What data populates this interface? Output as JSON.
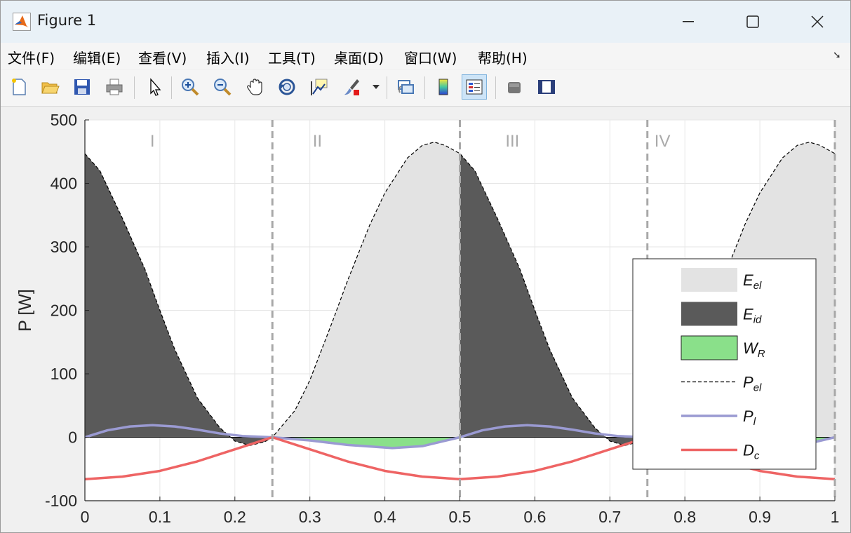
{
  "window": {
    "title": "Figure 1"
  },
  "menu": [
    "文件(F)",
    "编辑(E)",
    "查看(V)",
    "插入(I)",
    "工具(T)",
    "桌面(D)",
    "窗口(W)",
    "帮助(H)"
  ],
  "toolbar": [
    "new-figure-icon",
    "open-file-icon",
    "save-icon",
    "print-icon",
    "edit-plot-icon",
    "zoom-in-icon",
    "zoom-out-icon",
    "pan-icon",
    "rotate-3d-icon",
    "data-cursor-icon",
    "brush-icon",
    "link-plot-icon",
    "colorbar-icon",
    "legend-icon",
    "hide-plot-tools-icon",
    "show-plot-tools-icon"
  ],
  "chart_data": {
    "type": "area",
    "xlabel": "",
    "ylabel": "P [W]",
    "xlim": [
      0,
      1
    ],
    "ylim": [
      -100,
      500
    ],
    "xticks": [
      "0",
      "0.1",
      "0.2",
      "0.3",
      "0.4",
      "0.5",
      "0.6",
      "0.7",
      "0.8",
      "0.9",
      "1"
    ],
    "yticks": [
      "-100",
      "0",
      "100",
      "200",
      "300",
      "400",
      "500"
    ],
    "grid": true,
    "legend_position": "right",
    "region_labels": [
      {
        "text": "I",
        "x": 0.09
      },
      {
        "text": "II",
        "x": 0.31
      },
      {
        "text": "III",
        "x": 0.57
      },
      {
        "text": "IV",
        "x": 0.77
      }
    ],
    "phase_boundaries": [
      0.25,
      0.5,
      0.75,
      1.0
    ],
    "series": [
      {
        "name": "E_el",
        "kind": "area",
        "color": "#e3e3e3",
        "x": [
          0.25,
          0.28,
          0.3,
          0.33,
          0.35,
          0.38,
          0.4,
          0.43,
          0.45,
          0.466,
          0.48,
          0.5,
          0.75,
          0.78,
          0.8,
          0.83,
          0.85,
          0.88,
          0.9,
          0.93,
          0.95,
          0.966,
          0.98,
          1.0
        ],
        "y": [
          0,
          42,
          90,
          182,
          246,
          335,
          385,
          440,
          460,
          465,
          460,
          447,
          0,
          42,
          90,
          182,
          246,
          335,
          385,
          440,
          460,
          465,
          460,
          447
        ]
      },
      {
        "name": "E_id",
        "kind": "area",
        "color": "#5a5a5a",
        "x": [
          0,
          0.02,
          0.05,
          0.08,
          0.1,
          0.12,
          0.15,
          0.18,
          0.2,
          0.22,
          0.24,
          0.25,
          0.5,
          0.52,
          0.55,
          0.58,
          0.6,
          0.62,
          0.65,
          0.68,
          0.7,
          0.72,
          0.74,
          0.75
        ],
        "y": [
          447,
          420,
          345,
          265,
          200,
          138,
          62,
          15,
          -6,
          -13,
          -7,
          0,
          447,
          420,
          345,
          265,
          200,
          138,
          62,
          15,
          -6,
          -13,
          -7,
          0
        ]
      },
      {
        "name": "W_R",
        "kind": "area",
        "color": "#8ae08a",
        "x": [
          0.25,
          0.3,
          0.35,
          0.4,
          0.41,
          0.45,
          0.5,
          0.75,
          0.8,
          0.85,
          0.9,
          0.91,
          0.95,
          1.0
        ],
        "y": [
          0,
          -5,
          -12,
          -17,
          -17,
          -14,
          0,
          0,
          -5,
          -12,
          -17,
          -17,
          -14,
          0
        ]
      },
      {
        "name": "P_el",
        "kind": "dashed-line",
        "color": "#000000",
        "x": [
          0,
          0.02,
          0.05,
          0.08,
          0.1,
          0.12,
          0.15,
          0.18,
          0.2,
          0.22,
          0.24,
          0.25,
          0.28,
          0.3,
          0.33,
          0.35,
          0.38,
          0.4,
          0.43,
          0.45,
          0.466,
          0.48,
          0.5,
          0.52,
          0.55,
          0.58,
          0.6,
          0.62,
          0.65,
          0.68,
          0.7,
          0.72,
          0.74,
          0.75,
          0.78,
          0.8,
          0.83,
          0.85,
          0.88,
          0.9,
          0.93,
          0.95,
          0.966,
          0.98,
          1.0
        ],
        "y": [
          447,
          420,
          345,
          265,
          200,
          138,
          62,
          15,
          -6,
          -13,
          -7,
          0,
          42,
          90,
          182,
          246,
          335,
          385,
          440,
          460,
          465,
          460,
          447,
          420,
          345,
          265,
          200,
          138,
          62,
          15,
          -6,
          -13,
          -7,
          0,
          42,
          90,
          182,
          246,
          335,
          385,
          440,
          460,
          465,
          460,
          447
        ]
      },
      {
        "name": "P_l",
        "kind": "line",
        "color": "#9a9ad2",
        "x": [
          0,
          0.03,
          0.06,
          0.09,
          0.12,
          0.15,
          0.18,
          0.21,
          0.25,
          0.3,
          0.35,
          0.41,
          0.45,
          0.5,
          0.53,
          0.56,
          0.59,
          0.62,
          0.65,
          0.68,
          0.71,
          0.75,
          0.8,
          0.85,
          0.91,
          0.95,
          1.0
        ],
        "y": [
          0,
          11,
          17,
          19,
          17,
          12,
          6,
          2,
          0,
          -5,
          -12,
          -17,
          -14,
          0,
          11,
          17,
          19,
          17,
          12,
          6,
          2,
          0,
          -5,
          -12,
          -17,
          -14,
          0
        ]
      },
      {
        "name": "D_c",
        "kind": "line",
        "color": "#ee6464",
        "x": [
          0,
          0.05,
          0.1,
          0.15,
          0.2,
          0.25,
          0.3,
          0.35,
          0.4,
          0.45,
          0.5,
          0.55,
          0.6,
          0.65,
          0.7,
          0.75,
          0.8,
          0.85,
          0.9,
          0.95,
          1.0
        ],
        "y": [
          -66,
          -62,
          -53,
          -38,
          -19,
          0,
          -19,
          -38,
          -53,
          -62,
          -66,
          -62,
          -53,
          -38,
          -19,
          0,
          -19,
          -38,
          -53,
          -62,
          -66
        ]
      }
    ],
    "legend": [
      {
        "label": "E",
        "sub": "el",
        "kind": "patch",
        "color": "#e3e3e3"
      },
      {
        "label": "E",
        "sub": "id",
        "kind": "patch",
        "color": "#5a5a5a"
      },
      {
        "label": "W",
        "sub": "R",
        "kind": "patch",
        "color": "#8ae08a"
      },
      {
        "label": "P",
        "sub": "el",
        "kind": "dashed",
        "color": "#000000"
      },
      {
        "label": "P",
        "sub": "l",
        "kind": "line",
        "color": "#9a9ad2"
      },
      {
        "label": "D",
        "sub": "c",
        "kind": "line",
        "color": "#ee6464"
      }
    ]
  }
}
